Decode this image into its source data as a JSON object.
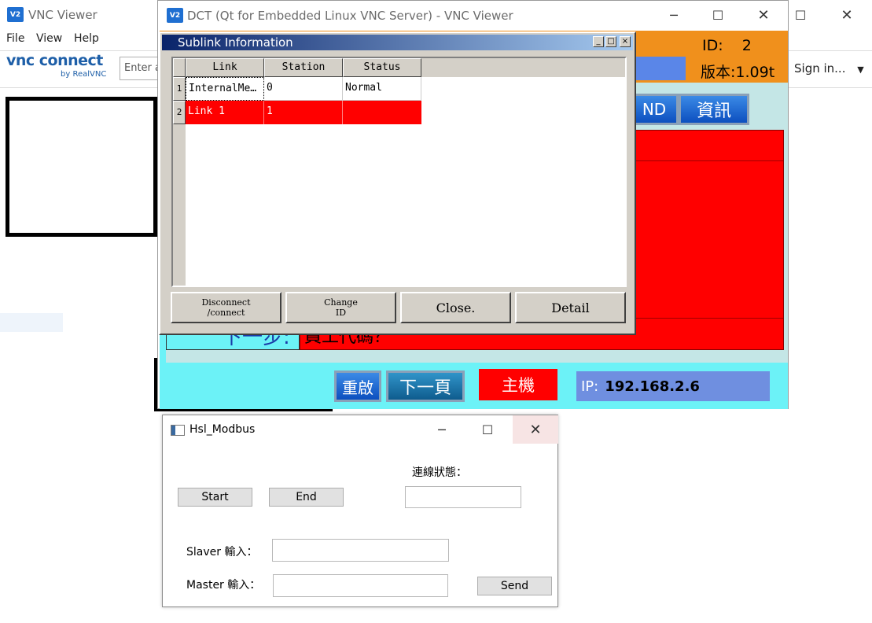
{
  "vnc_viewer": {
    "title": "VNC Viewer",
    "menu": [
      "File",
      "View",
      "Help"
    ],
    "brand": "vnc connect",
    "brand_sub": "by RealVNC",
    "search_placeholder": "Enter a",
    "sign_in": "Sign in...",
    "logo_text": "V2"
  },
  "dct_window": {
    "title": "DCT (Qt for Embedded Linux VNC Server) - VNC Viewer",
    "id_label": "ID:",
    "id_value": "2",
    "version_label": "版本:1.09t",
    "nd_button": "ND",
    "info_button": "資訊",
    "next_step_label": "下一步:",
    "next_step_text": "員工代碼？",
    "restart_button": "重啟",
    "next_page_button": "下一頁",
    "host_label": "主機",
    "ip_label": "IP:",
    "ip_value": "192.168.2.6"
  },
  "sublink_dialog": {
    "title": "Sublink Information",
    "columns": [
      "Link",
      "Station",
      "Status"
    ],
    "rows": [
      {
        "num": "1",
        "link": "InternalMe…",
        "station": "0",
        "status": "Normal"
      },
      {
        "num": "2",
        "link": "Link 1",
        "station": "1",
        "status": ""
      }
    ],
    "buttons": {
      "disconnect_line1": "Disconnect",
      "disconnect_line2": "/connect",
      "change_line1": "Change",
      "change_line2": "ID",
      "close": "Close.",
      "detail": "Detail"
    },
    "row_alert_color": "#ff0000"
  },
  "hsl_modbus": {
    "title": "Hsl_Modbus",
    "start_label": "Start",
    "end_label": "End",
    "status_label": "連線狀態：",
    "status_value": "",
    "slaver_label": "Slaver 輸入：",
    "slaver_value": "",
    "master_label": "Master 輸入：",
    "master_value": "",
    "send_label": "Send"
  },
  "colors": {
    "orange_header": "#f0901c",
    "cyan_panel": "#6cf2f7",
    "light_cyan": "#c4e6e6",
    "red_panel": "#ff0000",
    "ip_box": "#6f8fe0"
  }
}
